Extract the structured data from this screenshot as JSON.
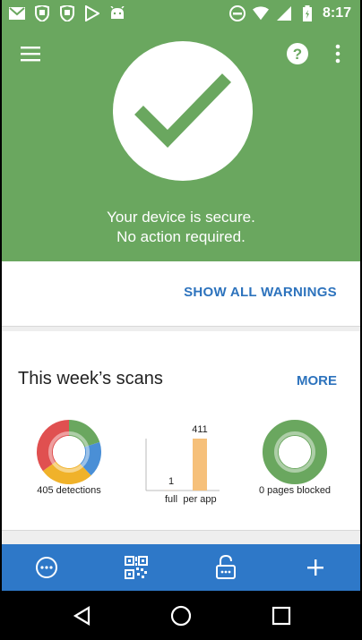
{
  "status_bar": {
    "time": "8:17",
    "left_icons": [
      "gmail-icon",
      "shield-icon",
      "shield-icon",
      "play-store-icon",
      "android-icon"
    ],
    "right_icons": [
      "do-not-disturb-icon",
      "wifi-icon",
      "signal-icon",
      "battery-icon"
    ]
  },
  "header": {
    "message_line1": "Your device is secure.",
    "message_line2": "No action required.",
    "background_color": "#6aa75f"
  },
  "warnings_card": {
    "button_label": "SHOW ALL WARNINGS"
  },
  "scans_card": {
    "title": "This week’s scans",
    "more_label": "MORE",
    "detections_label": "405 detections",
    "pages_blocked_label": "0 pages blocked"
  },
  "chart_data": [
    {
      "type": "pie",
      "slices": [
        {
          "color": "#6aa75f",
          "value": 0.2
        },
        {
          "color": "#4a8fd6",
          "value": 0.18
        },
        {
          "color": "#f0b22a",
          "value": 0.27
        },
        {
          "color": "#e05050",
          "value": 0.35
        }
      ],
      "caption": "405 detections"
    },
    {
      "type": "bar",
      "categories": [
        "full",
        "per app"
      ],
      "values": [
        1,
        411
      ],
      "ylim": [
        0,
        411
      ]
    },
    {
      "type": "pie",
      "slices": [
        {
          "color": "#6aa75f",
          "value": 1
        }
      ],
      "caption": "0 pages blocked"
    }
  ],
  "bottom_nav": {
    "items": [
      "chat-icon",
      "qr-code-icon",
      "unlock-icon",
      "plus-icon"
    ]
  },
  "colors": {
    "accent_blue": "#2d73bd",
    "nav_blue": "#2e78c8",
    "green": "#6aa75f"
  }
}
